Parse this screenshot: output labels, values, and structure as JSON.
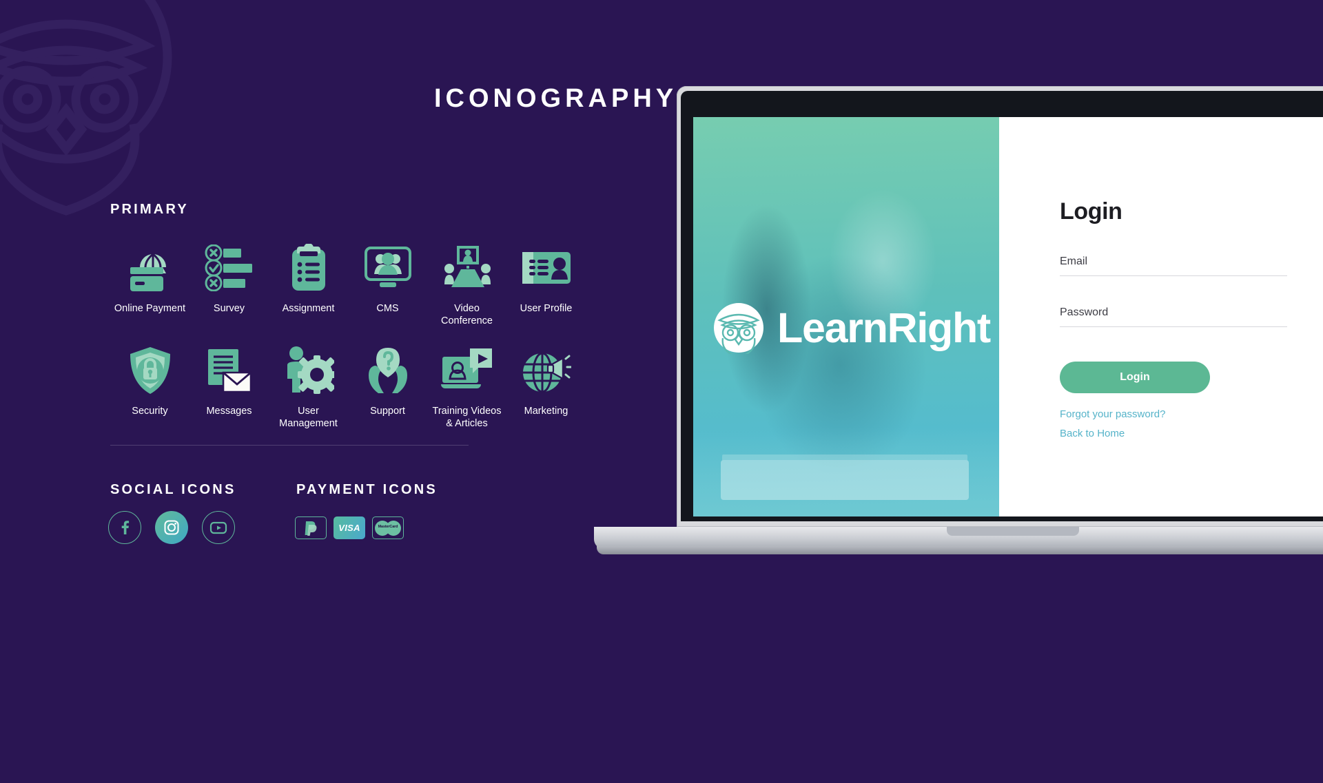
{
  "page": {
    "headline": "ICONOGRAPHY",
    "background_color": "#2a1553",
    "accent_color": "#5fb79b",
    "accent_light": "#a4d9c3",
    "cyan_color": "#55b3c9"
  },
  "sections": {
    "primary_title": "PRIMARY",
    "social_title": "SOCIAL ICONS",
    "payment_title": "PAYMENT ICONS"
  },
  "primary_icons": [
    {
      "label": "Online Payment",
      "icon": "online-payment-icon"
    },
    {
      "label": "Survey",
      "icon": "survey-icon"
    },
    {
      "label": "Assignment",
      "icon": "assignment-icon"
    },
    {
      "label": "CMS",
      "icon": "cms-icon"
    },
    {
      "label": "Video Conference",
      "icon": "video-conference-icon"
    },
    {
      "label": "User Profile",
      "icon": "user-profile-icon"
    },
    {
      "label": "Security",
      "icon": "security-icon"
    },
    {
      "label": "Messages",
      "icon": "messages-icon"
    },
    {
      "label": "User\nManagement",
      "icon": "user-management-icon"
    },
    {
      "label": "Support",
      "icon": "support-icon"
    },
    {
      "label": "Training Videos\n& Articles",
      "icon": "training-videos-icon"
    },
    {
      "label": "Marketing",
      "icon": "marketing-icon"
    }
  ],
  "social_icons": [
    {
      "name": "facebook-icon",
      "style": "outline"
    },
    {
      "name": "instagram-icon",
      "style": "filled"
    },
    {
      "name": "youtube-icon",
      "style": "outline"
    }
  ],
  "payment_icons": [
    {
      "name": "paypal-icon",
      "label": ""
    },
    {
      "name": "visa-icon",
      "label": "VISA"
    },
    {
      "name": "mastercard-icon",
      "label": "MasterCard"
    }
  ],
  "mockup": {
    "brand_name": "LearnRight",
    "logo": "owl-logo-icon",
    "login": {
      "title": "Login",
      "email_label": "Email",
      "password_label": "Password",
      "submit_label": "Login",
      "forgot_link": "Forgot your password?",
      "home_link": "Back to Home"
    }
  }
}
